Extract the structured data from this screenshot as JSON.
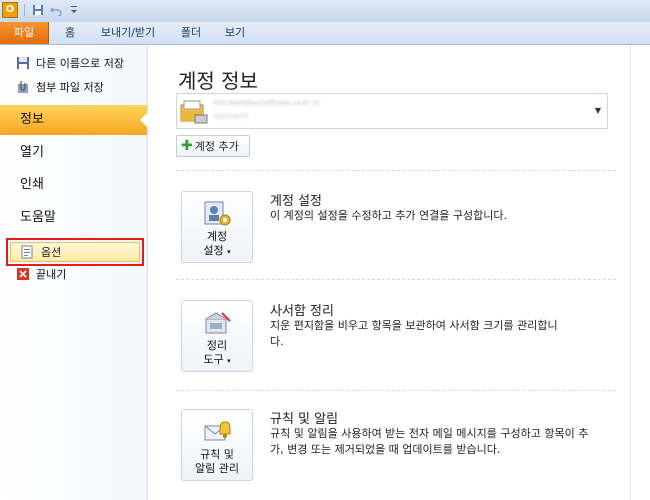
{
  "titlebar": {
    "app_icon": "O",
    "qat_icons": [
      "save-icon",
      "undo-icon",
      "customize-icon"
    ]
  },
  "ribbon": {
    "tabs": [
      "파일",
      "홈",
      "보내기/받기",
      "폴더",
      "보기"
    ],
    "active_tab": "파일"
  },
  "backstage_nav": {
    "save_as": "다른 이름으로 저장",
    "save_attachments": "첨부 파일 저장",
    "info": "정보",
    "open": "열기",
    "print": "인쇄",
    "help": "도움말",
    "options": "옵션",
    "exit": "끝내기",
    "active": "정보"
  },
  "info": {
    "title": "계정 정보",
    "account_line1": "info.dom@socialfunex.co.kr (I)",
    "account_line2": "POP/SMTP",
    "add_account": "계정 추가",
    "sections": [
      {
        "button_line1": "계정",
        "button_line2": "설정",
        "title": "계정 설정",
        "desc": "이 계정의 설정을 수정하고 추가 연결을 구성합니다."
      },
      {
        "button_line1": "정리",
        "button_line2": "도구",
        "title": "사서함 정리",
        "desc": "지운 편지함을 비우고 항목을 보관하여 사서함 크기를 관리합니다."
      },
      {
        "button_line1": "규칙 및",
        "button_line2": "알림 관리",
        "title": "규칙 및 알림",
        "desc": "규칙 및 알림을 사용하여 받는 전자 메일 메시지를 구성하고 항목이 추가, 변경 또는 제거되었을 때 업데이트를 받습니다."
      }
    ]
  },
  "colors": {
    "file_tab": "#e46b09",
    "active_nav": "#f7a522",
    "highlight_border": "#e41b1b"
  }
}
